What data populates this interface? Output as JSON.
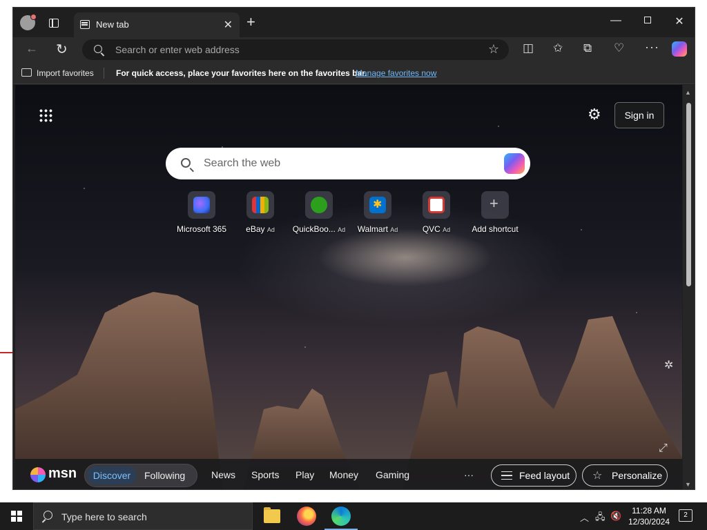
{
  "browser": {
    "tab_title": "New tab",
    "address_placeholder": "Search or enter web address"
  },
  "favorites_bar": {
    "import_label": "Import favorites",
    "quick_access_text": "For quick access, place your favorites here on the favorites bar.",
    "manage_link": "Manage favorites now"
  },
  "newtab": {
    "sign_in_label": "Sign in",
    "search_placeholder": "Search the web",
    "shortcuts": [
      {
        "name": "Microsoft 365",
        "ad": "",
        "logo_color": "#5b6cf0",
        "tile_color": "#3b3f6a"
      },
      {
        "name": "eBay",
        "ad": "Ad",
        "logo_color": "#e53238",
        "tile_color": "#1b1b1b"
      },
      {
        "name": "QuickBoo...",
        "ad": "Ad",
        "logo_color": "#2ca01c",
        "tile_color": "#1b1b1b"
      },
      {
        "name": "Walmart",
        "ad": "Ad",
        "logo_color": "#0071ce",
        "tile_color": "#0071ce"
      },
      {
        "name": "QVC",
        "ad": "Ad",
        "logo_color": "#d7382f",
        "tile_color": "#ffffff"
      },
      {
        "name": "Add shortcut",
        "ad": "",
        "logo_color": "#9e9e9e",
        "tile_color": "transparent"
      }
    ],
    "msn": {
      "brand": "msn",
      "tab_discover": "Discover",
      "tab_following": "Following",
      "nav": [
        "News",
        "Sports",
        "Play",
        "Money",
        "Gaming"
      ],
      "more": "···",
      "feed_layout_label": "Feed layout",
      "personalize_label": "Personalize"
    }
  },
  "taskbar": {
    "search_placeholder": "Type here to search",
    "time": "11:28 AM",
    "date": "12/30/2024",
    "notification_count": "2"
  }
}
